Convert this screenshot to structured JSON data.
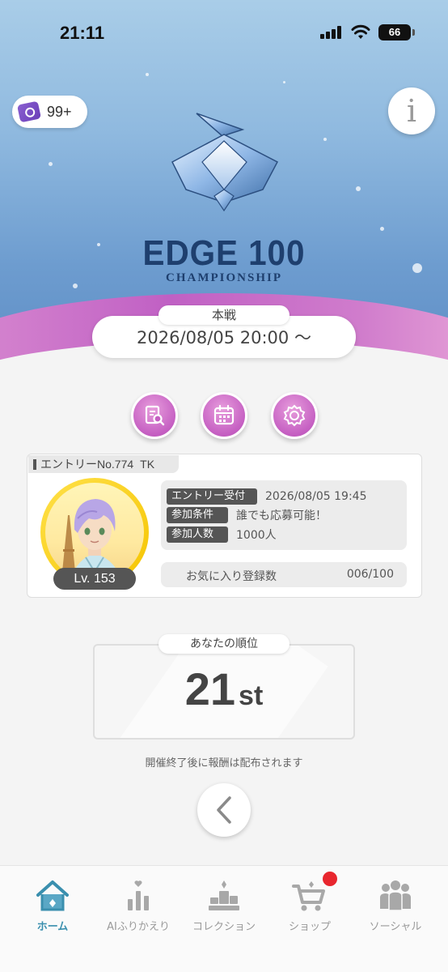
{
  "status_bar": {
    "time": "21:11",
    "battery": "66"
  },
  "header": {
    "ticket_count": "99+",
    "info_label": "i",
    "logo_title": "EDGE 100",
    "logo_subtitle": "CHAMPIONSHIP"
  },
  "event": {
    "stage_label": "本戦",
    "datetime": "2026/08/05 20:00 〜"
  },
  "action_buttons": [
    {
      "name": "details-icon"
    },
    {
      "name": "calendar-icon"
    },
    {
      "name": "award-icon"
    }
  ],
  "entry": {
    "number_label": "エントリーNo.774",
    "player_name": "TK",
    "level": "Lv. 153",
    "rows": [
      {
        "label": "エントリー受付",
        "value": "2026/08/05 19:45"
      },
      {
        "label": "参加条件",
        "value": "誰でも応募可能！"
      },
      {
        "label": "参加人数",
        "value": "1000人"
      }
    ],
    "favorites_label": "お気に入り登録数",
    "favorites_value": "006/100"
  },
  "rank": {
    "label": "あなたの順位",
    "number": "21",
    "suffix": "st",
    "note": "開催終了後に報酬は配布されます"
  },
  "tabs": [
    {
      "label": "ホーム",
      "icon": "home-icon",
      "active": true
    },
    {
      "label": "AIふりかえり",
      "icon": "stats-icon",
      "active": false
    },
    {
      "label": "コレクション",
      "icon": "trophy-icon",
      "active": false
    },
    {
      "label": "ショップ",
      "icon": "cart-icon",
      "active": false
    },
    {
      "label": "ソーシャル",
      "icon": "people-icon",
      "active": false
    }
  ],
  "colors": {
    "accent_purple": "#c55fc2",
    "active_tab": "#3a8fae",
    "notify_red": "#e8262e"
  }
}
